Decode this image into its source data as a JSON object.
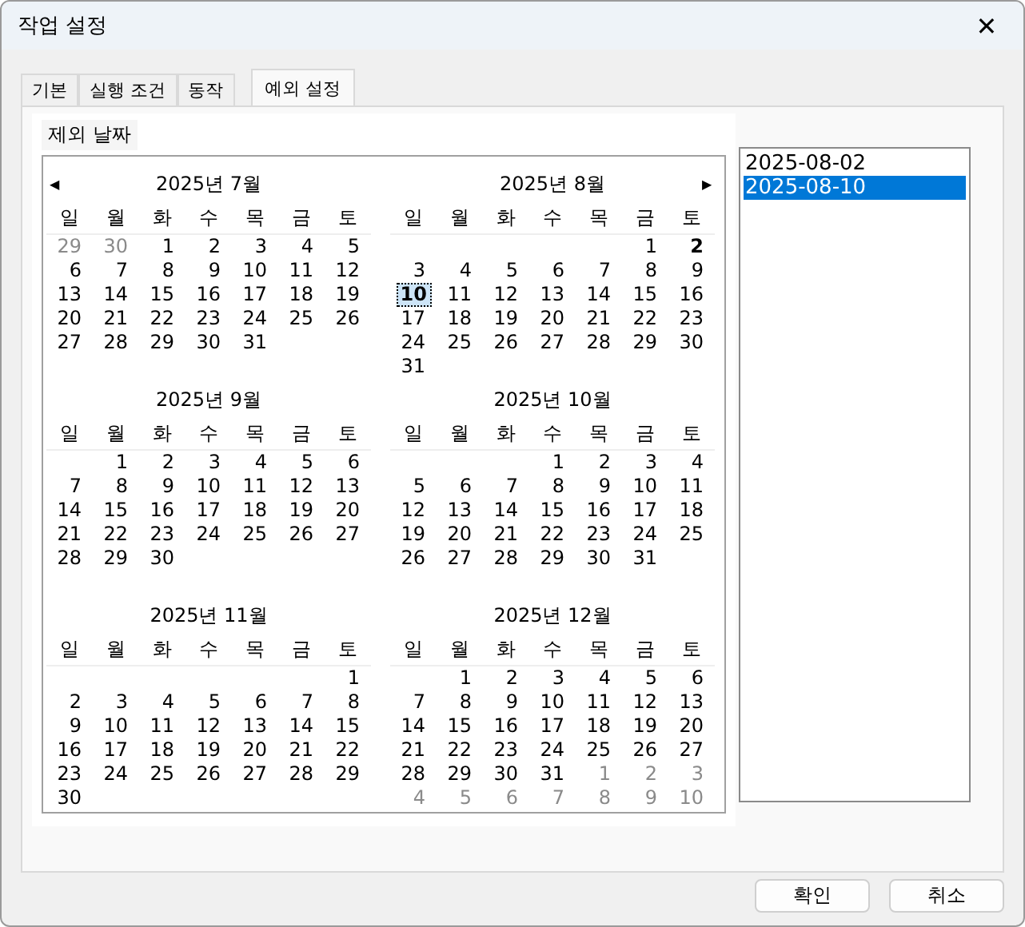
{
  "window": {
    "title": "작업 설정",
    "close": "✕"
  },
  "tabs": [
    {
      "label": "기본",
      "selected": false
    },
    {
      "label": "실행 조건",
      "selected": false
    },
    {
      "label": "동작",
      "selected": false
    },
    {
      "label": "예외 설정",
      "selected": true
    }
  ],
  "group": {
    "label": "제외 날짜"
  },
  "calendar": {
    "prev": "◀",
    "next": "▶",
    "months": [
      {
        "title": "2025년 7월",
        "weekdays": [
          "일",
          "월",
          "화",
          "수",
          "목",
          "금",
          "토"
        ],
        "weeks": [
          [
            {
              "day": "29",
              "kind": "adjacent"
            },
            {
              "day": "30",
              "kind": "adjacent"
            },
            {
              "day": "1",
              "kind": "day"
            },
            {
              "day": "2",
              "kind": "day"
            },
            {
              "day": "3",
              "kind": "day"
            },
            {
              "day": "4",
              "kind": "day"
            },
            {
              "day": "5",
              "kind": "day"
            }
          ],
          [
            {
              "day": "6",
              "kind": "day"
            },
            {
              "day": "7",
              "kind": "day"
            },
            {
              "day": "8",
              "kind": "day"
            },
            {
              "day": "9",
              "kind": "day"
            },
            {
              "day": "10",
              "kind": "day"
            },
            {
              "day": "11",
              "kind": "day"
            },
            {
              "day": "12",
              "kind": "day"
            }
          ],
          [
            {
              "day": "13",
              "kind": "day"
            },
            {
              "day": "14",
              "kind": "day"
            },
            {
              "day": "15",
              "kind": "day"
            },
            {
              "day": "16",
              "kind": "day"
            },
            {
              "day": "17",
              "kind": "day"
            },
            {
              "day": "18",
              "kind": "day"
            },
            {
              "day": "19",
              "kind": "day"
            }
          ],
          [
            {
              "day": "20",
              "kind": "day"
            },
            {
              "day": "21",
              "kind": "day"
            },
            {
              "day": "22",
              "kind": "day"
            },
            {
              "day": "23",
              "kind": "day"
            },
            {
              "day": "24",
              "kind": "day"
            },
            {
              "day": "25",
              "kind": "day"
            },
            {
              "day": "26",
              "kind": "day"
            }
          ],
          [
            {
              "day": "27",
              "kind": "day"
            },
            {
              "day": "28",
              "kind": "day"
            },
            {
              "day": "29",
              "kind": "day"
            },
            {
              "day": "30",
              "kind": "day"
            },
            {
              "day": "31",
              "kind": "day"
            }
          ]
        ]
      },
      {
        "title": "2025년 8월",
        "weekdays": [
          "일",
          "월",
          "화",
          "수",
          "목",
          "금",
          "토"
        ],
        "weeks": [
          [
            {
              "kind": "blank"
            },
            {
              "kind": "blank"
            },
            {
              "kind": "blank"
            },
            {
              "kind": "blank"
            },
            {
              "kind": "blank"
            },
            {
              "day": "1",
              "kind": "day"
            },
            {
              "day": "2",
              "kind": "marked"
            }
          ],
          [
            {
              "day": "3",
              "kind": "day"
            },
            {
              "day": "4",
              "kind": "day"
            },
            {
              "day": "5",
              "kind": "day"
            },
            {
              "day": "6",
              "kind": "day"
            },
            {
              "day": "7",
              "kind": "day"
            },
            {
              "day": "8",
              "kind": "day"
            },
            {
              "day": "9",
              "kind": "day"
            }
          ],
          [
            {
              "day": "10",
              "kind": "focused"
            },
            {
              "day": "11",
              "kind": "day"
            },
            {
              "day": "12",
              "kind": "day"
            },
            {
              "day": "13",
              "kind": "day"
            },
            {
              "day": "14",
              "kind": "day"
            },
            {
              "day": "15",
              "kind": "day"
            },
            {
              "day": "16",
              "kind": "day"
            }
          ],
          [
            {
              "day": "17",
              "kind": "day"
            },
            {
              "day": "18",
              "kind": "day"
            },
            {
              "day": "19",
              "kind": "day"
            },
            {
              "day": "20",
              "kind": "day"
            },
            {
              "day": "21",
              "kind": "day"
            },
            {
              "day": "22",
              "kind": "day"
            },
            {
              "day": "23",
              "kind": "day"
            }
          ],
          [
            {
              "day": "24",
              "kind": "day"
            },
            {
              "day": "25",
              "kind": "day"
            },
            {
              "day": "26",
              "kind": "day"
            },
            {
              "day": "27",
              "kind": "day"
            },
            {
              "day": "28",
              "kind": "day"
            },
            {
              "day": "29",
              "kind": "day"
            },
            {
              "day": "30",
              "kind": "day"
            }
          ],
          [
            {
              "day": "31",
              "kind": "day"
            }
          ]
        ]
      },
      {
        "title": "2025년 9월",
        "weekdays": [
          "일",
          "월",
          "화",
          "수",
          "목",
          "금",
          "토"
        ],
        "weeks": [
          [
            {
              "kind": "blank"
            },
            {
              "day": "1",
              "kind": "day"
            },
            {
              "day": "2",
              "kind": "day"
            },
            {
              "day": "3",
              "kind": "day"
            },
            {
              "day": "4",
              "kind": "day"
            },
            {
              "day": "5",
              "kind": "day"
            },
            {
              "day": "6",
              "kind": "day"
            }
          ],
          [
            {
              "day": "7",
              "kind": "day"
            },
            {
              "day": "8",
              "kind": "day"
            },
            {
              "day": "9",
              "kind": "day"
            },
            {
              "day": "10",
              "kind": "day"
            },
            {
              "day": "11",
              "kind": "day"
            },
            {
              "day": "12",
              "kind": "day"
            },
            {
              "day": "13",
              "kind": "day"
            }
          ],
          [
            {
              "day": "14",
              "kind": "day"
            },
            {
              "day": "15",
              "kind": "day"
            },
            {
              "day": "16",
              "kind": "day"
            },
            {
              "day": "17",
              "kind": "day"
            },
            {
              "day": "18",
              "kind": "day"
            },
            {
              "day": "19",
              "kind": "day"
            },
            {
              "day": "20",
              "kind": "day"
            }
          ],
          [
            {
              "day": "21",
              "kind": "day"
            },
            {
              "day": "22",
              "kind": "day"
            },
            {
              "day": "23",
              "kind": "day"
            },
            {
              "day": "24",
              "kind": "day"
            },
            {
              "day": "25",
              "kind": "day"
            },
            {
              "day": "26",
              "kind": "day"
            },
            {
              "day": "27",
              "kind": "day"
            }
          ],
          [
            {
              "day": "28",
              "kind": "day"
            },
            {
              "day": "29",
              "kind": "day"
            },
            {
              "day": "30",
              "kind": "day"
            }
          ]
        ]
      },
      {
        "title": "2025년 10월",
        "weekdays": [
          "일",
          "월",
          "화",
          "수",
          "목",
          "금",
          "토"
        ],
        "weeks": [
          [
            {
              "kind": "blank"
            },
            {
              "kind": "blank"
            },
            {
              "kind": "blank"
            },
            {
              "day": "1",
              "kind": "day"
            },
            {
              "day": "2",
              "kind": "day"
            },
            {
              "day": "3",
              "kind": "day"
            },
            {
              "day": "4",
              "kind": "day"
            }
          ],
          [
            {
              "day": "5",
              "kind": "day"
            },
            {
              "day": "6",
              "kind": "day"
            },
            {
              "day": "7",
              "kind": "day"
            },
            {
              "day": "8",
              "kind": "day"
            },
            {
              "day": "9",
              "kind": "day"
            },
            {
              "day": "10",
              "kind": "day"
            },
            {
              "day": "11",
              "kind": "day"
            }
          ],
          [
            {
              "day": "12",
              "kind": "day"
            },
            {
              "day": "13",
              "kind": "day"
            },
            {
              "day": "14",
              "kind": "day"
            },
            {
              "day": "15",
              "kind": "day"
            },
            {
              "day": "16",
              "kind": "day"
            },
            {
              "day": "17",
              "kind": "day"
            },
            {
              "day": "18",
              "kind": "day"
            }
          ],
          [
            {
              "day": "19",
              "kind": "day"
            },
            {
              "day": "20",
              "kind": "day"
            },
            {
              "day": "21",
              "kind": "day"
            },
            {
              "day": "22",
              "kind": "day"
            },
            {
              "day": "23",
              "kind": "day"
            },
            {
              "day": "24",
              "kind": "day"
            },
            {
              "day": "25",
              "kind": "day"
            }
          ],
          [
            {
              "day": "26",
              "kind": "day"
            },
            {
              "day": "27",
              "kind": "day"
            },
            {
              "day": "28",
              "kind": "day"
            },
            {
              "day": "29",
              "kind": "day"
            },
            {
              "day": "30",
              "kind": "day"
            },
            {
              "day": "31",
              "kind": "day"
            }
          ]
        ]
      },
      {
        "title": "2025년 11월",
        "weekdays": [
          "일",
          "월",
          "화",
          "수",
          "목",
          "금",
          "토"
        ],
        "weeks": [
          [
            {
              "kind": "blank"
            },
            {
              "kind": "blank"
            },
            {
              "kind": "blank"
            },
            {
              "kind": "blank"
            },
            {
              "kind": "blank"
            },
            {
              "kind": "blank"
            },
            {
              "day": "1",
              "kind": "day"
            }
          ],
          [
            {
              "day": "2",
              "kind": "day"
            },
            {
              "day": "3",
              "kind": "day"
            },
            {
              "day": "4",
              "kind": "day"
            },
            {
              "day": "5",
              "kind": "day"
            },
            {
              "day": "6",
              "kind": "day"
            },
            {
              "day": "7",
              "kind": "day"
            },
            {
              "day": "8",
              "kind": "day"
            }
          ],
          [
            {
              "day": "9",
              "kind": "day"
            },
            {
              "day": "10",
              "kind": "day"
            },
            {
              "day": "11",
              "kind": "day"
            },
            {
              "day": "12",
              "kind": "day"
            },
            {
              "day": "13",
              "kind": "day"
            },
            {
              "day": "14",
              "kind": "day"
            },
            {
              "day": "15",
              "kind": "day"
            }
          ],
          [
            {
              "day": "16",
              "kind": "day"
            },
            {
              "day": "17",
              "kind": "day"
            },
            {
              "day": "18",
              "kind": "day"
            },
            {
              "day": "19",
              "kind": "day"
            },
            {
              "day": "20",
              "kind": "day"
            },
            {
              "day": "21",
              "kind": "day"
            },
            {
              "day": "22",
              "kind": "day"
            }
          ],
          [
            {
              "day": "23",
              "kind": "day"
            },
            {
              "day": "24",
              "kind": "day"
            },
            {
              "day": "25",
              "kind": "day"
            },
            {
              "day": "26",
              "kind": "day"
            },
            {
              "day": "27",
              "kind": "day"
            },
            {
              "day": "28",
              "kind": "day"
            },
            {
              "day": "29",
              "kind": "day"
            }
          ],
          [
            {
              "day": "30",
              "kind": "day"
            }
          ]
        ]
      },
      {
        "title": "2025년 12월",
        "weekdays": [
          "일",
          "월",
          "화",
          "수",
          "목",
          "금",
          "토"
        ],
        "weeks": [
          [
            {
              "kind": "blank"
            },
            {
              "day": "1",
              "kind": "day"
            },
            {
              "day": "2",
              "kind": "day"
            },
            {
              "day": "3",
              "kind": "day"
            },
            {
              "day": "4",
              "kind": "day"
            },
            {
              "day": "5",
              "kind": "day"
            },
            {
              "day": "6",
              "kind": "day"
            }
          ],
          [
            {
              "day": "7",
              "kind": "day"
            },
            {
              "day": "8",
              "kind": "day"
            },
            {
              "day": "9",
              "kind": "day"
            },
            {
              "day": "10",
              "kind": "day"
            },
            {
              "day": "11",
              "kind": "day"
            },
            {
              "day": "12",
              "kind": "day"
            },
            {
              "day": "13",
              "kind": "day"
            }
          ],
          [
            {
              "day": "14",
              "kind": "day"
            },
            {
              "day": "15",
              "kind": "day"
            },
            {
              "day": "16",
              "kind": "day"
            },
            {
              "day": "17",
              "kind": "day"
            },
            {
              "day": "18",
              "kind": "day"
            },
            {
              "day": "19",
              "kind": "day"
            },
            {
              "day": "20",
              "kind": "day"
            }
          ],
          [
            {
              "day": "21",
              "kind": "day"
            },
            {
              "day": "22",
              "kind": "day"
            },
            {
              "day": "23",
              "kind": "day"
            },
            {
              "day": "24",
              "kind": "day"
            },
            {
              "day": "25",
              "kind": "day"
            },
            {
              "day": "26",
              "kind": "day"
            },
            {
              "day": "27",
              "kind": "day"
            }
          ],
          [
            {
              "day": "28",
              "kind": "day"
            },
            {
              "day": "29",
              "kind": "day"
            },
            {
              "day": "30",
              "kind": "day"
            },
            {
              "day": "31",
              "kind": "day"
            },
            {
              "day": "1",
              "kind": "adjacent"
            },
            {
              "day": "2",
              "kind": "adjacent"
            },
            {
              "day": "3",
              "kind": "adjacent"
            }
          ],
          [
            {
              "day": "4",
              "kind": "adjacent"
            },
            {
              "day": "5",
              "kind": "adjacent"
            },
            {
              "day": "6",
              "kind": "adjacent"
            },
            {
              "day": "7",
              "kind": "adjacent"
            },
            {
              "day": "8",
              "kind": "adjacent"
            },
            {
              "day": "9",
              "kind": "adjacent"
            },
            {
              "day": "10",
              "kind": "adjacent"
            }
          ]
        ]
      }
    ]
  },
  "date_list": [
    {
      "text": "2025-08-02",
      "selected": false
    },
    {
      "text": "2025-08-10",
      "selected": true
    }
  ],
  "buttons": [
    {
      "label": "확인"
    },
    {
      "label": "취소"
    }
  ]
}
